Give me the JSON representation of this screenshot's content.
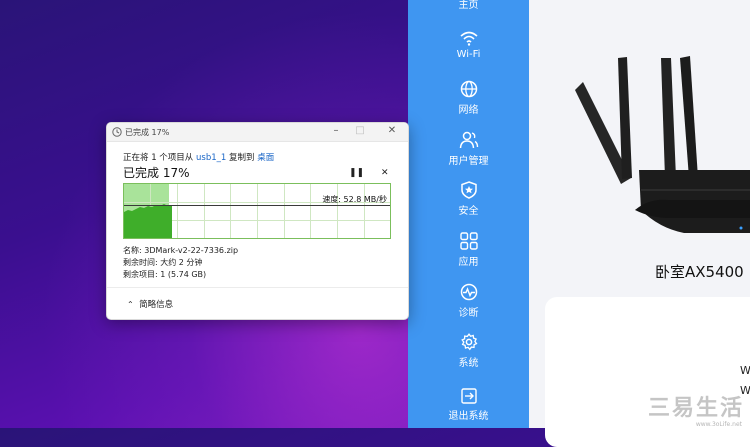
{
  "router": {
    "nav": [
      {
        "id": "home",
        "label": "主页",
        "icon": "home-icon"
      },
      {
        "id": "wifi",
        "label": "Wi-Fi",
        "icon": "wifi-icon"
      },
      {
        "id": "network",
        "label": "网络",
        "icon": "globe-icon"
      },
      {
        "id": "users",
        "label": "用户管理",
        "icon": "users-icon"
      },
      {
        "id": "security",
        "label": "安全",
        "icon": "shield-icon"
      },
      {
        "id": "apps",
        "label": "应用",
        "icon": "apps-grid-icon"
      },
      {
        "id": "diagnose",
        "label": "诊断",
        "icon": "pulse-icon"
      },
      {
        "id": "system",
        "label": "系统",
        "icon": "gear-icon"
      },
      {
        "id": "logout",
        "label": "退出系统",
        "icon": "logout-icon"
      }
    ],
    "device_name": "卧室AX5400",
    "card_labels": [
      "W",
      "W"
    ],
    "colors": {
      "sidebar": "#3f96f1",
      "main_bg": "#f3f4f8"
    }
  },
  "dialog": {
    "title": "已完成 17%",
    "copy_prefix": "正在将 1 个项目从 ",
    "source": "usb1_1",
    "copy_mid": " 复制到 ",
    "dest": "桌面",
    "percent_text": "已完成 17%",
    "progress_fraction": 0.17,
    "pause_icon": "pause-icon",
    "cancel_icon": "close-icon",
    "speed": "速度: 52.8 MB/秒",
    "name": "名称: 3DMark-v2-22-7336.zip",
    "time_left": "剩余时间: 大约 2 分钟",
    "items_left": "剩余项目: 1 (5.74 GB)",
    "less_info": "简略信息",
    "colors": {
      "graph_border": "#7bbf5c",
      "graph_fill": "#3fae2a",
      "link": "#1a66c7"
    }
  },
  "watermark": {
    "text": "三易生活",
    "sub": "www.3oLife.net"
  }
}
